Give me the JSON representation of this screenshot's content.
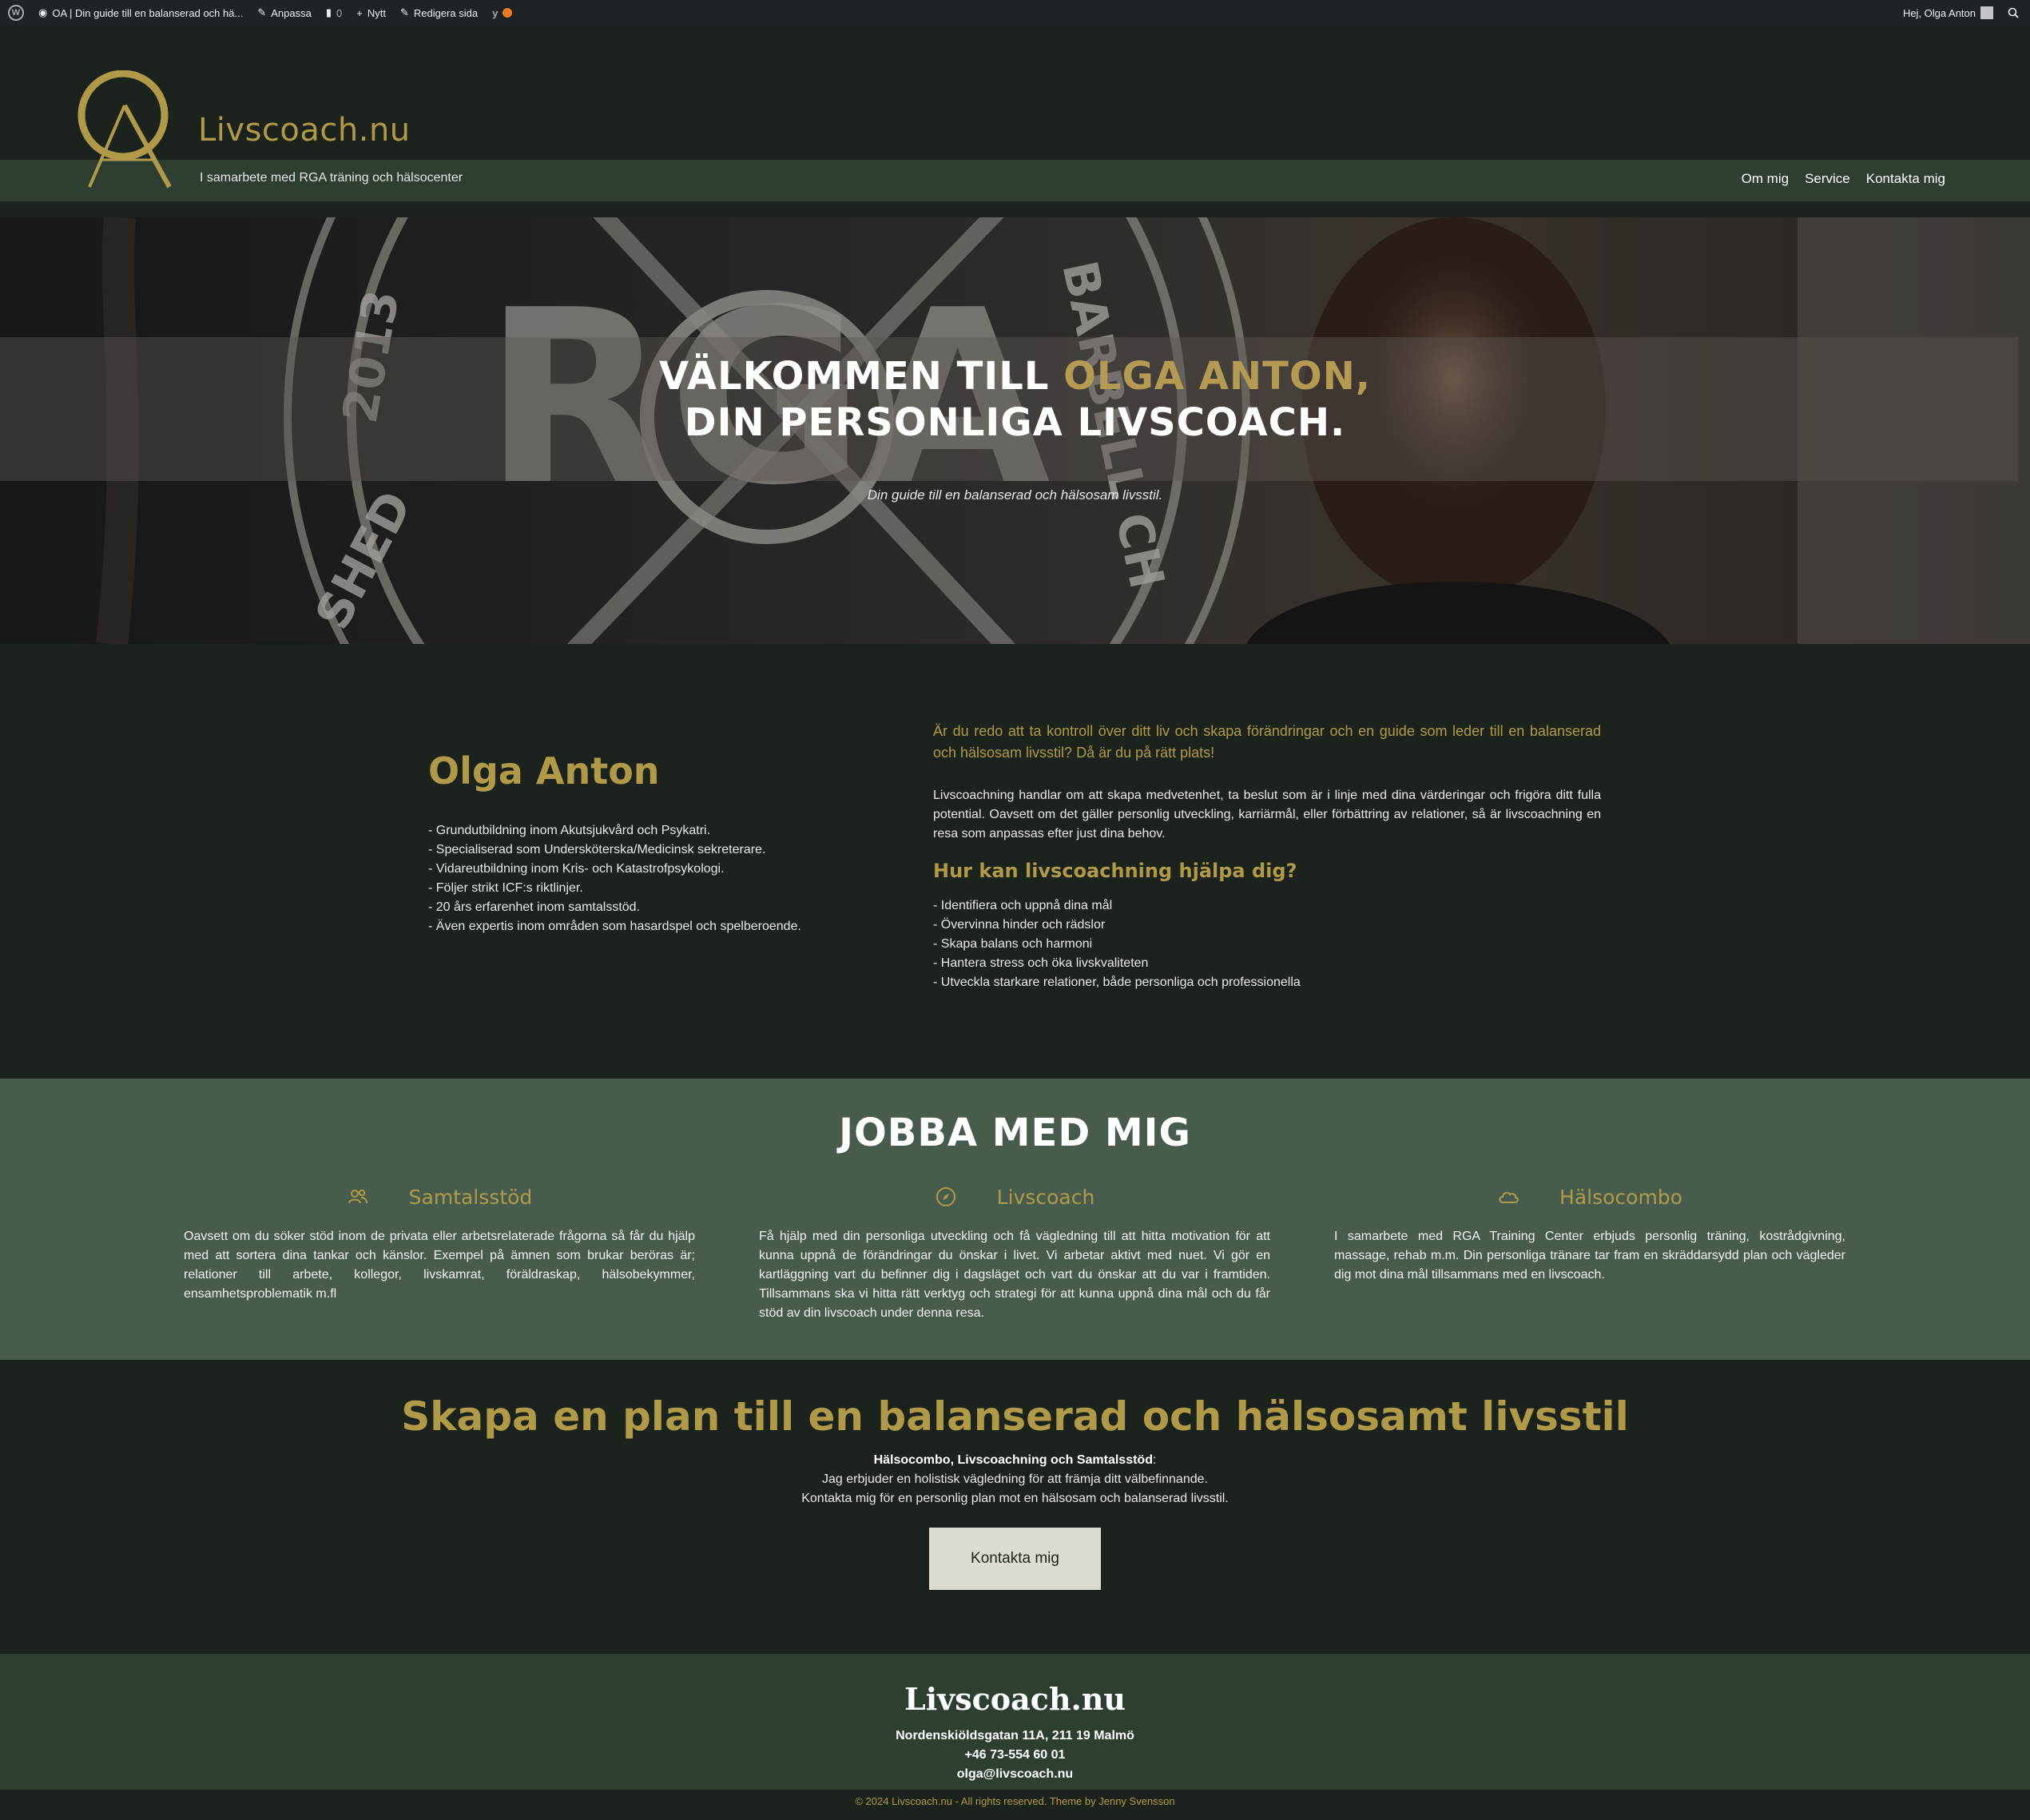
{
  "adminbar": {
    "site_label": "OA | Din guide till en balanserad och hä...",
    "customize": "Anpassa",
    "comments_count": "0",
    "new": "Nytt",
    "edit_page": "Redigera sida",
    "greeting": "Hej, Olga Anton"
  },
  "header": {
    "logo_letters": "OA",
    "site_title": "Livscoach.nu",
    "tagline": "I samarbete med RGA träning och hälsocenter",
    "nav": [
      "Om mig",
      "Service",
      "Kontakta mig"
    ]
  },
  "hero": {
    "title_part1": "VÄLKOMMEN TILL ",
    "title_accent": "OLGA ANTON,",
    "title_line2": "DIN PERSONLIGA LIVSCOACH.",
    "subtitle": "Din guide till en balanserad och hälsosam livsstil.",
    "background_text": {
      "letters": "RGA",
      "year": "2013",
      "side": "BARBELL CH",
      "established": "SHED"
    }
  },
  "about": {
    "name": "Olga Anton",
    "qualifications": [
      "- Grundutbildning inom Akutsjukvård och Psykatri.",
      "- Specialiserad som Undersköterska/Medicinsk sekreterare.",
      "- Vidareutbildning inom Kris- och Katastrofpsykologi.",
      "- Följer strikt ICF:s riktlinjer.",
      "- 20 års erfarenhet inom samtalsstöd.",
      "- Även expertis inom områden som hasardspel och spelberoende."
    ],
    "lead": "Är du redo att ta kontroll över ditt liv och skapa förändringar och en guide som leder till en balanserad och hälsosam livsstil? Då är du på rätt plats!",
    "body": "Livscoachning handlar om att skapa medvetenhet, ta beslut som är i linje med dina värderingar och frigöra ditt fulla potential. Oavsett om det gäller personlig utveckling, karriärmål, eller förbättring av relationer, så är livscoachning en resa som anpassas efter just dina behov.",
    "help_heading": "Hur kan livscoachning hjälpa dig?",
    "help_items": [
      "- Identifiera och uppnå dina mål",
      "- Övervinna hinder och rädslor",
      "- Skapa balans och harmoni",
      "- Hantera stress och öka livskvaliteten",
      "- Utveckla starkare relationer, både personliga och professionella"
    ]
  },
  "services": {
    "heading": "JOBBA MED MIG",
    "items": [
      {
        "title": "Samtalsstöd",
        "icon": "people-icon",
        "text": "Oavsett om du söker stöd inom de privata eller arbetsrelaterade frågorna så får du hjälp med att sortera dina tankar och känslor. Exempel på ämnen som brukar beröras är; relationer till arbete, kollegor, livskamrat, föräldraskap, hälsobekymmer, ensamhetsproblematik m.fl"
      },
      {
        "title": "Livscoach",
        "icon": "compass-icon",
        "text": "Få hjälp med din personliga utveckling och få vägledning till att hitta motivation för att kunna uppnå de förändringar du önskar i livet. Vi arbetar aktivt med nuet. Vi gör en kartläggning vart du befinner dig i dagsläget och vart du önskar att du var i framtiden. Tillsammans ska vi hitta rätt verktyg och strategi för att kunna uppnå dina mål och du får stöd av din livscoach under denna resa."
      },
      {
        "title": "Hälsocombo",
        "icon": "cloud-icon",
        "text": "I samarbete med RGA Training Center erbjuds personlig träning, kostrådgivning, massage, rehab m.m. Din personliga tränare tar fram en skräddarsydd plan och vägleder dig mot dina mål tillsammans med en livscoach."
      }
    ]
  },
  "plan": {
    "heading": "Skapa en plan till en balanserad och hälsosamt livsstil",
    "bold_line": "Hälsocombo, Livscoachning och Samtalsstöd",
    "colon": ":",
    "line2": "Jag erbjuder en holistisk vägledning för att främja ditt välbefinnande.",
    "line3": "Kontakta mig för en personlig plan mot en hälsosam och balanserad livsstil.",
    "button": "Kontakta mig"
  },
  "footer": {
    "title": "Livscoach.nu",
    "address": "Nordenskiöldsgatan 11A, 211 19 Malmö",
    "phone": "+46 73-554 60 01",
    "email": "olga@livscoach.nu",
    "copyright": "© 2024 Livscoach.nu - All rights reserved. Theme by Jenny Svensson"
  },
  "colors": {
    "background": "#1c231d",
    "nav_band": "#2e3e31",
    "services_bg": "#475c4c",
    "accent_gold": "#b09a4a",
    "button_bg": "#dcdcd3"
  }
}
